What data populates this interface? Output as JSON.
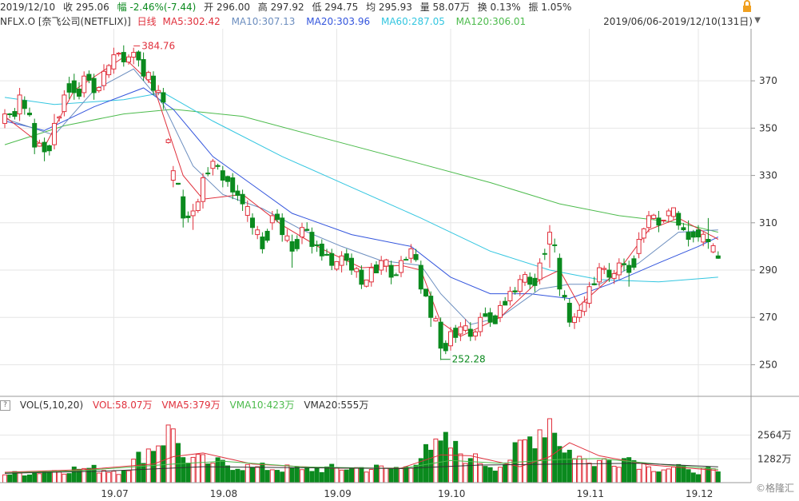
{
  "topbar": {
    "date": "2019/12/10",
    "close": "收 295.06",
    "change": "幅 -2.46%(-7.44)",
    "open": "开 296.00",
    "high": "高 297.92",
    "low": "低 294.75",
    "avg": "均 295.93",
    "volume": "量 58.07万",
    "turnover": "换 0.13%",
    "amplitude": "振 1.05%",
    "lock_icon": "lock-icon"
  },
  "legend": {
    "symbol": "NFLX.O [奈飞公司(NETFLIX)]",
    "period": "日线",
    "ma5": "MA5:302.42",
    "ma10": "MA10:307.13",
    "ma20": "MA20:303.96",
    "ma60": "MA60:287.05",
    "ma120": "MA120:306.01",
    "range": "2019/06/06-2019/12/10(131日)"
  },
  "vol_legend": {
    "help": "?",
    "title": "VOL(5,10,20)",
    "vol": "VOL:58.07万",
    "vma5": "VMA5:379万",
    "vma10": "VMA10:423万",
    "vma20": "VMA20:555万"
  },
  "watermark": "©格隆汇",
  "colors": {
    "up": "#e0303c",
    "down": "#0b8a1e",
    "ma5": "#e0303c",
    "ma10": "#6c8ebf",
    "ma20": "#3355dd",
    "ma60": "#33c6e0",
    "ma120": "#4cbb4c",
    "grid": "#e6e6e6"
  },
  "chart_data": {
    "type": "candlestick",
    "price_axis": {
      "ticks": [
        "370",
        "350",
        "330",
        "310",
        "290",
        "270",
        "250"
      ],
      "range": [
        238,
        392
      ]
    },
    "volume_axis": {
      "ticks": [
        "2564万",
        "1282万"
      ],
      "range": [
        0,
        3450
      ]
    },
    "x_ticks": [
      "19.07",
      "19.08",
      "19.09",
      "19.10",
      "19.11",
      "19.12"
    ],
    "annotations": {
      "high": "384.76",
      "low": "252.28"
    },
    "key_points": [
      {
        "x": 0,
        "o": 352,
        "c": 356,
        "l": 350,
        "h": 358
      },
      {
        "x": 3,
        "o": 356,
        "c": 364,
        "l": 353,
        "h": 367
      },
      {
        "x": 6,
        "o": 352,
        "c": 342,
        "l": 339,
        "h": 354
      },
      {
        "x": 8,
        "o": 344,
        "c": 340,
        "l": 336,
        "h": 346
      },
      {
        "x": 10,
        "o": 343,
        "c": 352,
        "l": 341,
        "h": 356
      },
      {
        "x": 12,
        "o": 357,
        "c": 364,
        "l": 355,
        "h": 366
      },
      {
        "x": 14,
        "o": 370,
        "c": 365,
        "l": 362,
        "h": 373
      },
      {
        "x": 16,
        "o": 365,
        "c": 372,
        "l": 363,
        "h": 374
      },
      {
        "x": 18,
        "o": 371,
        "c": 365,
        "l": 362,
        "h": 373
      },
      {
        "x": 20,
        "o": 368,
        "c": 374,
        "l": 366,
        "h": 377
      },
      {
        "x": 22,
        "o": 375,
        "c": 381,
        "l": 373,
        "h": 384
      },
      {
        "x": 24,
        "o": 382,
        "c": 378,
        "l": 376,
        "h": 385
      },
      {
        "x": 26,
        "o": 380,
        "c": 382,
        "l": 377,
        "h": 384
      },
      {
        "x": 28,
        "o": 379,
        "c": 372,
        "l": 370,
        "h": 382
      },
      {
        "x": 30,
        "o": 372,
        "c": 366,
        "l": 364,
        "h": 374
      },
      {
        "x": 32,
        "o": 365,
        "c": 361,
        "l": 358,
        "h": 367
      },
      {
        "x": 34,
        "o": 328,
        "c": 332,
        "l": 325,
        "h": 334
      },
      {
        "x": 36,
        "o": 321,
        "c": 312,
        "l": 308,
        "h": 324
      },
      {
        "x": 38,
        "o": 313,
        "c": 315,
        "l": 307,
        "h": 318
      },
      {
        "x": 40,
        "o": 319,
        "c": 329,
        "l": 316,
        "h": 331
      },
      {
        "x": 42,
        "o": 333,
        "c": 336,
        "l": 330,
        "h": 337
      },
      {
        "x": 44,
        "o": 332,
        "c": 328,
        "l": 325,
        "h": 334
      },
      {
        "x": 46,
        "o": 329,
        "c": 323,
        "l": 320,
        "h": 331
      },
      {
        "x": 48,
        "o": 322,
        "c": 318,
        "l": 315,
        "h": 324
      },
      {
        "x": 50,
        "o": 312,
        "c": 308,
        "l": 305,
        "h": 314
      },
      {
        "x": 52,
        "o": 304,
        "c": 299,
        "l": 297,
        "h": 306
      },
      {
        "x": 54,
        "o": 310,
        "c": 313,
        "l": 307,
        "h": 315
      },
      {
        "x": 56,
        "o": 312,
        "c": 305,
        "l": 302,
        "h": 314
      },
      {
        "x": 58,
        "o": 302,
        "c": 298,
        "l": 291,
        "h": 305
      },
      {
        "x": 60,
        "o": 304,
        "c": 308,
        "l": 301,
        "h": 310
      },
      {
        "x": 62,
        "o": 306,
        "c": 300,
        "l": 297,
        "h": 308
      },
      {
        "x": 64,
        "o": 301,
        "c": 296,
        "l": 294,
        "h": 303
      },
      {
        "x": 66,
        "o": 297,
        "c": 292,
        "l": 290,
        "h": 299
      },
      {
        "x": 68,
        "o": 292,
        "c": 296,
        "l": 289,
        "h": 298
      },
      {
        "x": 70,
        "o": 295,
        "c": 290,
        "l": 288,
        "h": 297
      },
      {
        "x": 72,
        "o": 290,
        "c": 284,
        "l": 282,
        "h": 292
      },
      {
        "x": 74,
        "o": 285,
        "c": 291,
        "l": 283,
        "h": 293
      },
      {
        "x": 76,
        "o": 290,
        "c": 294,
        "l": 288,
        "h": 296
      },
      {
        "x": 78,
        "o": 292,
        "c": 287,
        "l": 284,
        "h": 294
      },
      {
        "x": 80,
        "o": 289,
        "c": 294,
        "l": 287,
        "h": 296
      },
      {
        "x": 82,
        "o": 295,
        "c": 299,
        "l": 293,
        "h": 301
      },
      {
        "x": 84,
        "o": 292,
        "c": 282,
        "l": 280,
        "h": 294
      },
      {
        "x": 86,
        "o": 279,
        "c": 270,
        "l": 266,
        "h": 281
      },
      {
        "x": 88,
        "o": 268,
        "c": 257,
        "l": 252,
        "h": 270
      },
      {
        "x": 90,
        "o": 258,
        "c": 264,
        "l": 256,
        "h": 266
      },
      {
        "x": 92,
        "o": 263,
        "c": 266,
        "l": 260,
        "h": 268
      },
      {
        "x": 94,
        "o": 265,
        "c": 262,
        "l": 260,
        "h": 268
      },
      {
        "x": 96,
        "o": 264,
        "c": 270,
        "l": 262,
        "h": 272
      },
      {
        "x": 98,
        "o": 272,
        "c": 268,
        "l": 266,
        "h": 274
      },
      {
        "x": 100,
        "o": 270,
        "c": 275,
        "l": 268,
        "h": 277
      },
      {
        "x": 102,
        "o": 277,
        "c": 281,
        "l": 275,
        "h": 283
      },
      {
        "x": 104,
        "o": 281,
        "c": 286,
        "l": 279,
        "h": 288
      },
      {
        "x": 106,
        "o": 287,
        "c": 284,
        "l": 282,
        "h": 289
      },
      {
        "x": 108,
        "o": 286,
        "c": 293,
        "l": 284,
        "h": 295
      },
      {
        "x": 110,
        "o": 301,
        "c": 306,
        "l": 291,
        "h": 309
      },
      {
        "x": 112,
        "o": 295,
        "c": 282,
        "l": 279,
        "h": 297
      },
      {
        "x": 114,
        "o": 276,
        "c": 268,
        "l": 266,
        "h": 278
      },
      {
        "x": 116,
        "o": 270,
        "c": 273,
        "l": 268,
        "h": 275
      },
      {
        "x": 118,
        "o": 276,
        "c": 283,
        "l": 274,
        "h": 285
      },
      {
        "x": 120,
        "o": 285,
        "c": 291,
        "l": 283,
        "h": 293
      },
      {
        "x": 122,
        "o": 290,
        "c": 287,
        "l": 285,
        "h": 293
      },
      {
        "x": 124,
        "o": 288,
        "c": 293,
        "l": 286,
        "h": 295
      },
      {
        "x": 126,
        "o": 292,
        "c": 289,
        "l": 283,
        "h": 294
      },
      {
        "x": 128,
        "o": 297,
        "c": 303,
        "l": 295,
        "h": 306
      },
      {
        "x": 130,
        "o": 308,
        "c": 313,
        "l": 306,
        "h": 315
      },
      {
        "x": 132,
        "o": 312,
        "c": 309,
        "l": 306,
        "h": 315
      },
      {
        "x": 134,
        "o": 313,
        "c": 315,
        "l": 310,
        "h": 316
      },
      {
        "x": 136,
        "o": 314,
        "c": 309,
        "l": 307,
        "h": 315
      },
      {
        "x": 138,
        "o": 306,
        "c": 303,
        "l": 300,
        "h": 311
      },
      {
        "x": 140,
        "o": 307,
        "c": 304,
        "l": 302,
        "h": 309
      },
      {
        "x": 142,
        "o": 303,
        "c": 302,
        "l": 299,
        "h": 312
      },
      {
        "x": 144,
        "o": 296,
        "c": 295,
        "l": 294.75,
        "h": 297.92
      }
    ],
    "volume_samples": [
      {
        "x": 0,
        "v": 420
      },
      {
        "x": 8,
        "v": 610
      },
      {
        "x": 16,
        "v": 760
      },
      {
        "x": 24,
        "v": 640
      },
      {
        "x": 34,
        "v": 2900
      },
      {
        "x": 36,
        "v": 1350
      },
      {
        "x": 42,
        "v": 1050
      },
      {
        "x": 50,
        "v": 820
      },
      {
        "x": 60,
        "v": 700
      },
      {
        "x": 70,
        "v": 780
      },
      {
        "x": 80,
        "v": 760
      },
      {
        "x": 86,
        "v": 1750
      },
      {
        "x": 88,
        "v": 2250
      },
      {
        "x": 94,
        "v": 1300
      },
      {
        "x": 100,
        "v": 830
      },
      {
        "x": 110,
        "v": 3450
      },
      {
        "x": 112,
        "v": 1950
      },
      {
        "x": 114,
        "v": 1750
      },
      {
        "x": 118,
        "v": 1050
      },
      {
        "x": 126,
        "v": 1350
      },
      {
        "x": 130,
        "v": 850
      },
      {
        "x": 138,
        "v": 700
      },
      {
        "x": 144,
        "v": 580
      }
    ],
    "ma_series": [
      {
        "name": "MA5",
        "points": [
          [
            0,
            355
          ],
          [
            8,
            342
          ],
          [
            14,
            366
          ],
          [
            24,
            380
          ],
          [
            30,
            368
          ],
          [
            36,
            330
          ],
          [
            40,
            320
          ],
          [
            48,
            322
          ],
          [
            56,
            309
          ],
          [
            64,
            299
          ],
          [
            72,
            291
          ],
          [
            80,
            292
          ],
          [
            84,
            290
          ],
          [
            88,
            268
          ],
          [
            92,
            262
          ],
          [
            100,
            270
          ],
          [
            108,
            286
          ],
          [
            112,
            290
          ],
          [
            116,
            275
          ],
          [
            124,
            290
          ],
          [
            130,
            307
          ],
          [
            136,
            312
          ],
          [
            144,
            303
          ]
        ]
      },
      {
        "name": "MA10",
        "points": [
          [
            0,
            354
          ],
          [
            10,
            347
          ],
          [
            18,
            366
          ],
          [
            26,
            375
          ],
          [
            32,
            360
          ],
          [
            38,
            334
          ],
          [
            44,
            322
          ],
          [
            52,
            316
          ],
          [
            60,
            307
          ],
          [
            68,
            300
          ],
          [
            76,
            294
          ],
          [
            84,
            292
          ],
          [
            88,
            280
          ],
          [
            94,
            267
          ],
          [
            100,
            270
          ],
          [
            108,
            282
          ],
          [
            114,
            284
          ],
          [
            120,
            284
          ],
          [
            128,
            293
          ],
          [
            136,
            306
          ],
          [
            144,
            307
          ]
        ]
      },
      {
        "name": "MA20",
        "points": [
          [
            0,
            353
          ],
          [
            8,
            349
          ],
          [
            18,
            359
          ],
          [
            28,
            367
          ],
          [
            34,
            358
          ],
          [
            42,
            338
          ],
          [
            50,
            326
          ],
          [
            58,
            314
          ],
          [
            70,
            305
          ],
          [
            82,
            300
          ],
          [
            90,
            287
          ],
          [
            98,
            280
          ],
          [
            106,
            280
          ],
          [
            114,
            278
          ],
          [
            122,
            284
          ],
          [
            132,
            293
          ],
          [
            140,
            300
          ],
          [
            144,
            304
          ]
        ]
      },
      {
        "name": "MA60",
        "points": [
          [
            0,
            363
          ],
          [
            10,
            360
          ],
          [
            24,
            362
          ],
          [
            32,
            365
          ],
          [
            42,
            353
          ],
          [
            56,
            338
          ],
          [
            70,
            325
          ],
          [
            84,
            312
          ],
          [
            98,
            298
          ],
          [
            110,
            290
          ],
          [
            120,
            286
          ],
          [
            132,
            285
          ],
          [
            144,
            287
          ]
        ]
      },
      {
        "name": "MA120",
        "points": [
          [
            0,
            343
          ],
          [
            12,
            351
          ],
          [
            24,
            356
          ],
          [
            34,
            358
          ],
          [
            48,
            355
          ],
          [
            64,
            346
          ],
          [
            82,
            336
          ],
          [
            98,
            327
          ],
          [
            112,
            318
          ],
          [
            124,
            313
          ],
          [
            136,
            310
          ],
          [
            144,
            306
          ]
        ]
      }
    ],
    "vma_series": [
      {
        "name": "VMA5",
        "points": [
          [
            0,
            560
          ],
          [
            16,
            700
          ],
          [
            30,
            1000
          ],
          [
            34,
            1400
          ],
          [
            40,
            1600
          ],
          [
            50,
            1000
          ],
          [
            66,
            780
          ],
          [
            80,
            780
          ],
          [
            88,
            1500
          ],
          [
            94,
            1450
          ],
          [
            104,
            860
          ],
          [
            110,
            1400
          ],
          [
            114,
            2150
          ],
          [
            120,
            1450
          ],
          [
            130,
            960
          ],
          [
            144,
            650
          ]
        ]
      },
      {
        "name": "VMA10",
        "points": [
          [
            0,
            520
          ],
          [
            16,
            660
          ],
          [
            34,
            1000
          ],
          [
            44,
            1150
          ],
          [
            60,
            850
          ],
          [
            80,
            760
          ],
          [
            90,
            1200
          ],
          [
            100,
            1050
          ],
          [
            112,
            1250
          ],
          [
            120,
            1300
          ],
          [
            134,
            950
          ],
          [
            144,
            720
          ]
        ]
      },
      {
        "name": "VMA20",
        "points": [
          [
            0,
            500
          ],
          [
            20,
            620
          ],
          [
            40,
            860
          ],
          [
            60,
            800
          ],
          [
            80,
            760
          ],
          [
            96,
            950
          ],
          [
            112,
            1000
          ],
          [
            128,
            1050
          ],
          [
            144,
            850
          ]
        ]
      }
    ]
  }
}
